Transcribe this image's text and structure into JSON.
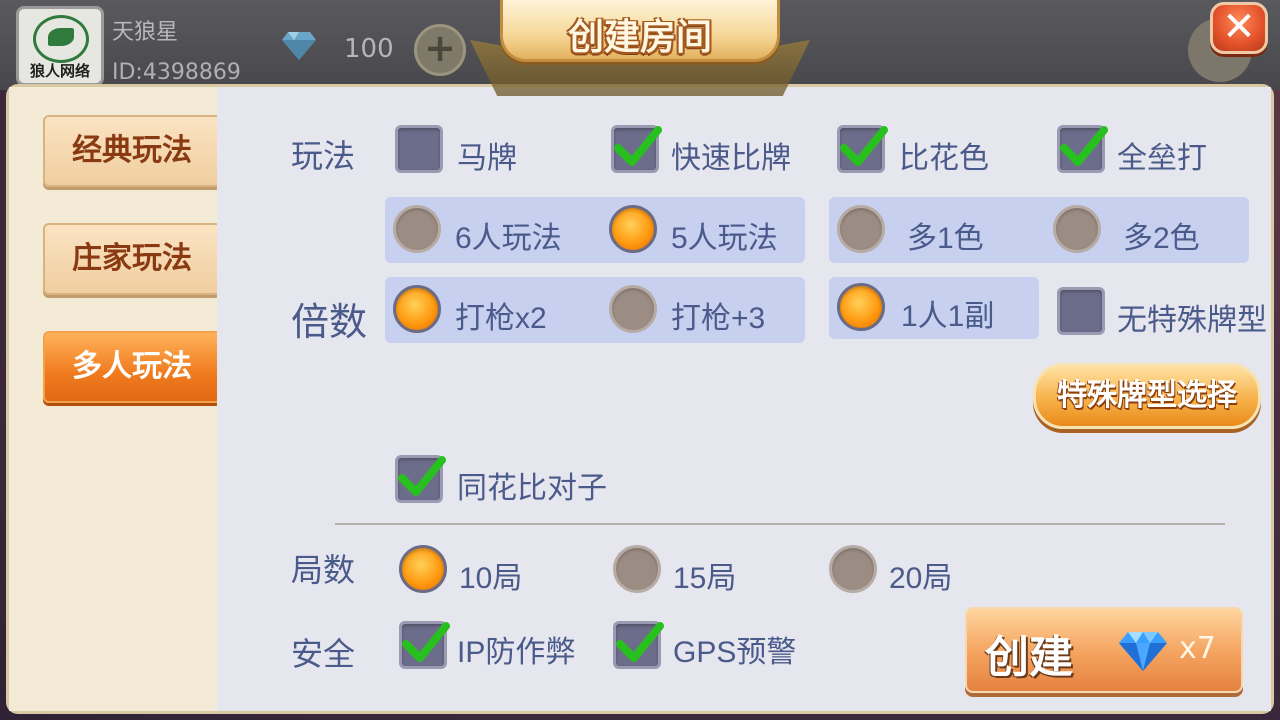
{
  "header": {
    "avatar_caption": "狼人网络",
    "username": "天狼星",
    "user_id": "ID:4398869",
    "balance": "100",
    "plus_symbol": "+"
  },
  "dialog": {
    "title": "创建房间",
    "close_symbol": "✕"
  },
  "tabs": [
    {
      "label": "经典玩法",
      "active": false
    },
    {
      "label": "庄家玩法",
      "active": false
    },
    {
      "label": "多人玩法",
      "active": true
    }
  ],
  "wanfa": {
    "label": "玩法",
    "options": [
      {
        "label": "马牌",
        "checked": false
      },
      {
        "label": "快速比牌",
        "checked": true
      },
      {
        "label": "比花色",
        "checked": true
      },
      {
        "label": "全垒打",
        "checked": true
      }
    ]
  },
  "players": {
    "options": [
      {
        "label": "6人玩法",
        "selected": false
      },
      {
        "label": "5人玩法",
        "selected": true
      }
    ]
  },
  "colors": {
    "options": [
      {
        "label": "多1色",
        "selected": false
      },
      {
        "label": "多2色",
        "selected": false
      }
    ]
  },
  "beishu": {
    "label": "倍数",
    "options": [
      {
        "label": "打枪x2",
        "selected": true
      },
      {
        "label": "打枪+3",
        "selected": false
      },
      {
        "label": "1人1副",
        "selected": true
      }
    ],
    "no_special": {
      "label": "无特殊牌型",
      "checked": false
    }
  },
  "special_button": "特殊牌型选择",
  "flush_pair": {
    "label": "同花比对子",
    "checked": true
  },
  "rounds": {
    "label": "局数",
    "options": [
      {
        "label": "10局",
        "selected": true
      },
      {
        "label": "15局",
        "selected": false
      },
      {
        "label": "20局",
        "selected": false
      }
    ]
  },
  "security": {
    "label": "安全",
    "options": [
      {
        "label": "IP防作弊",
        "checked": true
      },
      {
        "label": "GPS预警",
        "checked": true
      }
    ]
  },
  "create": {
    "label": "创建",
    "cost": "x7"
  },
  "theme": {
    "accent": "#f07a1e",
    "label_color": "#4a5a8a",
    "panel_bg": "#e6e6ee",
    "group_bg": "#c8d0f0"
  }
}
